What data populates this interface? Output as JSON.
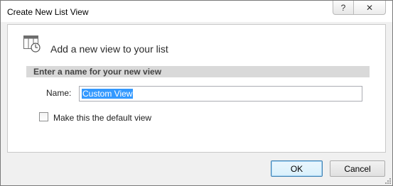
{
  "dialog": {
    "title": "Create New List View",
    "help_label": "?",
    "close_label": "✕"
  },
  "header": {
    "icon": "list-view-icon",
    "text": "Add a new view to your list"
  },
  "section": {
    "title": "Enter a name for your new view"
  },
  "name_field": {
    "label": "Name:",
    "value": "Custom View"
  },
  "default_checkbox": {
    "label": "Make this the default view",
    "checked": false
  },
  "buttons": {
    "ok": "OK",
    "cancel": "Cancel"
  }
}
